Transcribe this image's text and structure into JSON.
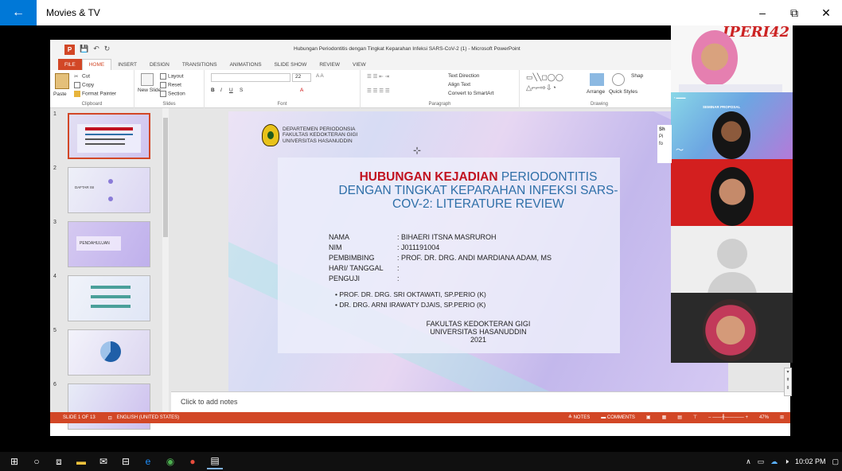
{
  "app": {
    "title": "Movies & TV",
    "back_icon": "back-arrow-icon"
  },
  "window_controls": {
    "minimize": "–",
    "maximize": "⧉",
    "close": "✕"
  },
  "powerpoint": {
    "doc_title": "Hubungan Periodontitis dengan Tingkat Keparahan Infeksi SARS-CoV-2 (1) - Microsoft PowerPoint",
    "tabs": [
      "FILE",
      "HOME",
      "INSERT",
      "DESIGN",
      "TRANSITIONS",
      "ANIMATIONS",
      "SLIDE SHOW",
      "REVIEW",
      "VIEW"
    ],
    "active_tab": "HOME",
    "ribbon": {
      "clipboard": {
        "paste": "Paste",
        "cut": "Cut",
        "copy": "Copy",
        "format_painter": "Format Painter",
        "group": "Clipboard"
      },
      "slides": {
        "new_slide": "New Slide",
        "layout": "Layout",
        "reset": "Reset",
        "section": "Section",
        "group": "Slides"
      },
      "font": {
        "size": "22",
        "group": "Font"
      },
      "paragraph": {
        "text_direction": "Text Direction",
        "align_text": "Align Text",
        "convert": "Convert to SmartArt",
        "group": "Paragraph"
      },
      "drawing": {
        "arrange": "Arrange",
        "quick_styles": "Quick Styles",
        "shape": "Shap",
        "group": "Drawing"
      }
    },
    "thumbnails": [
      "1",
      "2",
      "3",
      "4",
      "5",
      "6"
    ],
    "thumb_labels": {
      "t3": "PENDAHULUAN",
      "t2": "DAFTAR ISI"
    },
    "slide": {
      "inst_lines": [
        "DEPARTEMEN PERIODONSIA",
        "FAKULTAS KEDOKTERAN GIGI",
        "UNIVERSITAS HASANUDDIN"
      ],
      "title_red": "HUBUNGAN KEJADIAN",
      "title_rest1": " PERIODONTITIS",
      "title_line2": "DENGAN TINGKAT KEPARAHAN INFEKSI SARS-",
      "title_line3": "COV-2: LITERATURE REVIEW",
      "info": [
        {
          "k": "NAMA",
          "v": ": BIHAERI ITSNA MASRUROH"
        },
        {
          "k": "NIM",
          "v": ": J011191004"
        },
        {
          "k": "PEMBIMBING",
          "v": ": PROF. DR. DRG. ANDI MARDIANA ADAM, MS"
        },
        {
          "k": "HARI/ TANGGAL",
          "v": ":"
        },
        {
          "k": "PENGUJI",
          "v": ":"
        }
      ],
      "bullets": [
        "PROF. DR. DRG. SRI OKTAWATI, SP.PERIO (K)",
        "DR. DRG. ARNI IRAWATY DJAIS, SP.PERIO (K)"
      ],
      "faculty": [
        "FAKULTAS KEDOKTERAN GIGI",
        "UNIVERSITAS HASANUDDIN",
        "2021"
      ]
    },
    "notes_placeholder": "Click to add notes",
    "status": {
      "slide_of": "SLIDE 1 OF 13",
      "language": "ENGLISH (UNITED STATES)",
      "notes": "NOTES",
      "comments": "COMMENTS",
      "zoom": "47%"
    }
  },
  "participants": {
    "logo_text": "IPERI42",
    "seminar": "SEMINAR PROPOSAL",
    "sh_text": "Sh",
    "pi_text": "Pi",
    "fo_text": "fo"
  },
  "taskbar": {
    "time": "10:02 PM"
  }
}
